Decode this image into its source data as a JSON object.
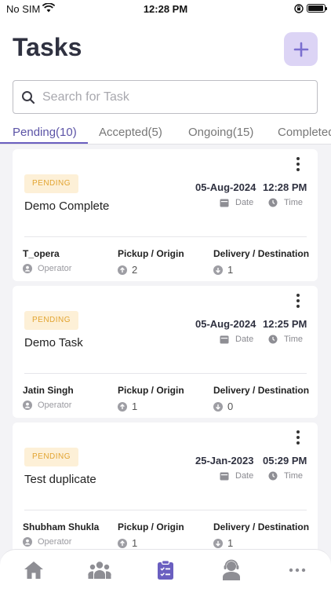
{
  "status_bar": {
    "carrier": "No SIM",
    "time": "12:28 PM"
  },
  "header": {
    "title": "Tasks"
  },
  "search": {
    "placeholder": "Search for Task"
  },
  "tabs": [
    {
      "label": "Pending(10)",
      "active": true
    },
    {
      "label": "Accepted(5)",
      "active": false
    },
    {
      "label": "Ongoing(15)",
      "active": false
    },
    {
      "label": "Completed",
      "active": false
    }
  ],
  "labels": {
    "date": "Date",
    "time": "Time",
    "pickup": "Pickup / Origin",
    "delivery": "Delivery / Destination",
    "operator": "Operator"
  },
  "tasks": [
    {
      "status": "PENDING",
      "title": "Demo Complete",
      "date": "05-Aug-2024",
      "time": "12:28 PM",
      "operator_name": "T_opera",
      "pickup_count": "2",
      "delivery_count": "1"
    },
    {
      "status": "PENDING",
      "title": "Demo Task",
      "date": "05-Aug-2024",
      "time": "12:25 PM",
      "operator_name": "Jatin Singh",
      "pickup_count": "1",
      "delivery_count": "0"
    },
    {
      "status": "PENDING",
      "title": "Test duplicate",
      "date": "25-Jan-2023",
      "time": "05:29 PM",
      "operator_name": "Shubham Shukla",
      "pickup_count": "1",
      "delivery_count": "1"
    }
  ],
  "bottom_nav": [
    {
      "icon": "home-icon",
      "active": false
    },
    {
      "icon": "team-icon",
      "active": false
    },
    {
      "icon": "tasks-icon",
      "active": true
    },
    {
      "icon": "support-agent-icon",
      "active": false
    },
    {
      "icon": "more-icon",
      "active": false
    }
  ],
  "colors": {
    "accent": "#6a5fc0",
    "add_button_bg": "#dcd4f5",
    "pending_badge_bg": "#fdf0d7",
    "pending_badge_text": "#e2a431",
    "title_text": "#2f3140"
  }
}
